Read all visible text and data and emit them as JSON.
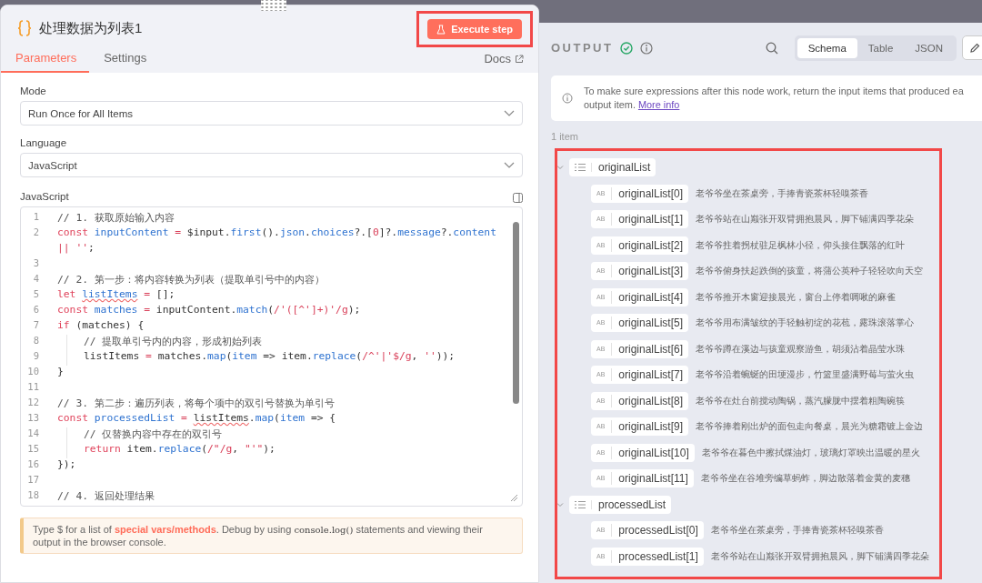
{
  "node": {
    "title": "处理数据为列表1",
    "execute_button": "Execute step"
  },
  "tabs": [
    {
      "label": "Parameters",
      "selected": true
    },
    {
      "label": "Settings",
      "selected": false
    }
  ],
  "docs_link": "Docs",
  "fields": [
    {
      "kind": "select",
      "label": "Mode",
      "value": "Run Once for All Items"
    },
    {
      "kind": "select",
      "label": "Language",
      "value": "JavaScript"
    }
  ],
  "editor": {
    "label": "JavaScript",
    "lines": [
      {
        "n": "1",
        "t": [
          {
            "kind": "c",
            "text": "// 1. 获取原始输入内容"
          }
        ]
      },
      {
        "n": "2",
        "t": [
          {
            "kind": "k",
            "text": "const "
          },
          {
            "kind": "v",
            "text": "inputContent"
          },
          {
            "kind": "o",
            "text": " = "
          },
          {
            "kind": "p",
            "text": "$input."
          },
          {
            "kind": "v",
            "text": "first"
          },
          {
            "kind": "p",
            "text": "()."
          },
          {
            "kind": "v",
            "text": "json"
          },
          {
            "kind": "p",
            "text": "."
          },
          {
            "kind": "v",
            "text": "choices"
          },
          {
            "kind": "p",
            "text": "?.["
          },
          {
            "kind": "s",
            "text": "0"
          },
          {
            "kind": "p",
            "text": "]?."
          },
          {
            "kind": "v",
            "text": "message"
          },
          {
            "kind": "p",
            "text": "?."
          },
          {
            "kind": "v",
            "text": "content"
          }
        ]
      },
      {
        "t": [
          {
            "kind": "s",
            "text": "|| ''"
          },
          {
            "kind": "p",
            "text": ";"
          }
        ]
      },
      {
        "n": "3"
      },
      {
        "n": "4",
        "t": [
          {
            "kind": "c",
            "text": "// 2. 第一步：将内容转换为列表（提取单引号中的内容）"
          }
        ]
      },
      {
        "n": "5",
        "t": [
          {
            "kind": "k",
            "text": "let "
          },
          {
            "kind": "vw",
            "text": "listItems"
          },
          {
            "kind": "o",
            "text": " = "
          },
          {
            "kind": "p",
            "text": "[];"
          }
        ]
      },
      {
        "n": "6",
        "t": [
          {
            "kind": "k",
            "text": "const "
          },
          {
            "kind": "v",
            "text": "matches"
          },
          {
            "kind": "o",
            "text": " = "
          },
          {
            "kind": "p",
            "text": "inputContent."
          },
          {
            "kind": "v",
            "text": "match"
          },
          {
            "kind": "p",
            "text": "("
          },
          {
            "kind": "s",
            "text": "/'([^']+)'/g"
          },
          {
            "kind": "p",
            "text": ");"
          }
        ]
      },
      {
        "n": "7",
        "t": [
          {
            "kind": "k",
            "text": "if"
          },
          {
            "kind": "p",
            "text": " (matches) {"
          }
        ]
      },
      {
        "n": "8",
        "indented": true,
        "t": [
          {
            "kind": "c",
            "text": "// 提取单引号内的内容，形成初始列表"
          }
        ]
      },
      {
        "n": "9",
        "indented": true,
        "t": [
          {
            "kind": "p",
            "text": "listItems"
          },
          {
            "kind": "o",
            "text": " = "
          },
          {
            "kind": "p",
            "text": "matches."
          },
          {
            "kind": "v",
            "text": "map"
          },
          {
            "kind": "p",
            "text": "("
          },
          {
            "kind": "v",
            "text": "item"
          },
          {
            "kind": "p",
            "text": " => item."
          },
          {
            "kind": "v",
            "text": "replace"
          },
          {
            "kind": "p",
            "text": "("
          },
          {
            "kind": "s",
            "text": "/^'|'$/g"
          },
          {
            "kind": "p",
            "text": ", "
          },
          {
            "kind": "s",
            "text": "''"
          },
          {
            "kind": "p",
            "text": "));"
          }
        ]
      },
      {
        "n": "10",
        "t": [
          {
            "kind": "p",
            "text": "}"
          }
        ]
      },
      {
        "n": "11"
      },
      {
        "n": "12",
        "t": [
          {
            "kind": "c",
            "text": "// 3. 第二步：遍历列表，将每个项中的双引号替换为单引号"
          }
        ]
      },
      {
        "n": "13",
        "t": [
          {
            "kind": "k",
            "text": "const "
          },
          {
            "kind": "v",
            "text": "processedList"
          },
          {
            "kind": "o",
            "text": " = "
          },
          {
            "kind": "pw",
            "text": "listItems"
          },
          {
            "kind": "p",
            "text": "."
          },
          {
            "kind": "v",
            "text": "map"
          },
          {
            "kind": "p",
            "text": "("
          },
          {
            "kind": "v",
            "text": "item"
          },
          {
            "kind": "p",
            "text": " => {"
          }
        ]
      },
      {
        "n": "14",
        "indented": true,
        "t": [
          {
            "kind": "c",
            "text": "// 仅替换内容中存在的双引号"
          }
        ]
      },
      {
        "n": "15",
        "indented": true,
        "t": [
          {
            "kind": "k",
            "text": "return"
          },
          {
            "kind": "p",
            "text": " item."
          },
          {
            "kind": "v",
            "text": "replace"
          },
          {
            "kind": "p",
            "text": "("
          },
          {
            "kind": "s",
            "text": "/\"/g"
          },
          {
            "kind": "p",
            "text": ", "
          },
          {
            "kind": "s",
            "text": "\"'\""
          },
          {
            "kind": "p",
            "text": ");"
          }
        ]
      },
      {
        "n": "16",
        "t": [
          {
            "kind": "p",
            "text": "});"
          }
        ]
      },
      {
        "n": "17"
      },
      {
        "n": "18",
        "t": [
          {
            "kind": "c",
            "text": "// 4. 返回处理结果"
          }
        ]
      }
    ]
  },
  "hint": [
    {
      "kind": "text",
      "text": "Type $ for a list of "
    },
    {
      "kind": "link",
      "text": "special vars/methods"
    },
    {
      "kind": "text",
      "text": ". Debug by using "
    },
    {
      "kind": "code",
      "text": "console.log()"
    },
    {
      "kind": "text",
      "text": " statements and viewing their output in the browser console."
    }
  ],
  "output": {
    "title": "OUTPUT",
    "succeeded": true,
    "views": [
      {
        "label": "Schema",
        "selected": true
      },
      {
        "label": "Table",
        "selected": false
      },
      {
        "label": "JSON",
        "selected": false
      }
    ],
    "notice": {
      "lines": [
        "To make sure expressions after this node work, return the input items that produced ea",
        "output item."
      ],
      "link": "More info"
    },
    "count": "1 item",
    "tree": [
      {
        "key": "originalList",
        "kind": "array",
        "expanded": true,
        "children": [
          {
            "kind": "string",
            "badge": "AB",
            "key": "originalList[0]",
            "value": "老爷爷坐在茶桌旁，手捧青瓷茶杯轻嗅茶香"
          },
          {
            "kind": "string",
            "badge": "AB",
            "key": "originalList[1]",
            "value": "老爷爷站在山巅张开双臂拥抱晨风，脚下铺满四季花朵"
          },
          {
            "kind": "string",
            "badge": "AB",
            "key": "originalList[2]",
            "value": "老爷爷拄着拐杖驻足枫林小径，仰头接住飘落的红叶"
          },
          {
            "kind": "string",
            "badge": "AB",
            "key": "originalList[3]",
            "value": "老爷爷俯身扶起跌倒的孩童，将蒲公英种子轻轻吹向天空"
          },
          {
            "kind": "string",
            "badge": "AB",
            "key": "originalList[4]",
            "value": "老爷爷推开木窗迎接晨光，窗台上停着啁啾的麻雀"
          },
          {
            "kind": "string",
            "badge": "AB",
            "key": "originalList[5]",
            "value": "老爷爷用布满皱纹的手轻触初绽的花苞，露珠滚落掌心"
          },
          {
            "kind": "string",
            "badge": "AB",
            "key": "originalList[6]",
            "value": "老爷爷蹲在溪边与孩童观察游鱼，胡须沾着晶莹水珠"
          },
          {
            "kind": "string",
            "badge": "AB",
            "key": "originalList[7]",
            "value": "老爷爷沿着蜿蜒的田埂漫步，竹篮里盛满野莓与萤火虫"
          },
          {
            "kind": "string",
            "badge": "AB",
            "key": "originalList[8]",
            "value": "老爷爷在灶台前搅动陶锅，蒸汽朦胧中摆着粗陶碗筷"
          },
          {
            "kind": "string",
            "badge": "AB",
            "key": "originalList[9]",
            "value": "老爷爷捧着刚出炉的面包走向餐桌，晨光为糖霜镀上金边"
          },
          {
            "kind": "string",
            "badge": "AB",
            "key": "originalList[10]",
            "value": "老爷爷在暮色中擦拭煤油灯，玻璃灯罩映出温暖的星火"
          },
          {
            "kind": "string",
            "badge": "AB",
            "key": "originalList[11]",
            "value": "老爷爷坐在谷堆旁编草蚂蚱，脚边散落着金黄的麦穗"
          }
        ]
      },
      {
        "key": "processedList",
        "kind": "array",
        "expanded": true,
        "children": [
          {
            "kind": "string",
            "badge": "AB",
            "key": "processedList[0]",
            "value": "老爷爷坐在茶桌旁，手捧青瓷茶杯轻嗅茶香"
          },
          {
            "kind": "string",
            "badge": "AB",
            "key": "processedList[1]",
            "value": "老爷爷站在山巅张开双臂拥抱晨风，脚下铺满四季花朵"
          }
        ]
      }
    ]
  }
}
